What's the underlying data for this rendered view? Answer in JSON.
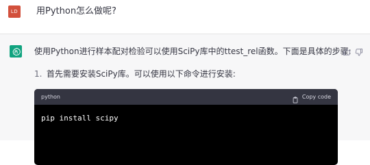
{
  "user": {
    "avatar_text": "LD",
    "message": "用Python怎么做呢?"
  },
  "assistant": {
    "intro": "使用Python进行样本配对检验可以使用SciPy库中的ttest_rel函数。下面是具体的步骤:",
    "list_items": [
      {
        "number": "1.",
        "text": "首先需要安装SciPy库。可以使用以下命令进行安装:"
      }
    ],
    "code_block": {
      "language": "python",
      "copy_label": "Copy code",
      "code": "pip install scipy"
    }
  },
  "icons": {
    "avatar": "chatgpt-logo-icon",
    "feedback_up": "thumbs-up-icon",
    "feedback_down": "thumbs-down-icon",
    "copy": "clipboard-icon"
  },
  "colors": {
    "brand": "#10a37f",
    "user_avatar": "#d2503c",
    "code_header_bg": "#343541",
    "code_bg": "#000000"
  }
}
